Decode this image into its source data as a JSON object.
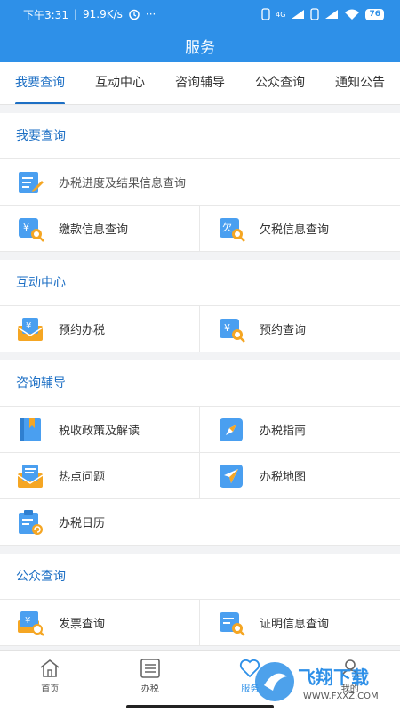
{
  "status": {
    "time": "下午3:31",
    "speed": "91.9K/s",
    "dots": "···",
    "network": "4G",
    "battery": "76"
  },
  "header": {
    "title": "服务"
  },
  "tabs": [
    {
      "label": "我要查询"
    },
    {
      "label": "互动中心"
    },
    {
      "label": "咨询辅导"
    },
    {
      "label": "公众查询"
    },
    {
      "label": "通知公告"
    }
  ],
  "sections": {
    "query": {
      "title": "我要查询",
      "items": [
        "办税进度及结果信息查询",
        "缴款信息查询",
        "欠税信息查询"
      ]
    },
    "interact": {
      "title": "互动中心",
      "items": [
        "预约办税",
        "预约查询"
      ]
    },
    "consult": {
      "title": "咨询辅导",
      "items": [
        "税收政策及解读",
        "办税指南",
        "热点问题",
        "办税地图",
        "办税日历"
      ]
    },
    "public": {
      "title": "公众查询",
      "items": [
        "发票查询",
        "证明信息查询"
      ]
    }
  },
  "bottom_nav": [
    {
      "label": "首页",
      "icon": "home-icon"
    },
    {
      "label": "办税",
      "icon": "list-icon"
    },
    {
      "label": "服务",
      "icon": "heart-icon"
    },
    {
      "label": "我的",
      "icon": "user-icon"
    }
  ],
  "watermark": {
    "brand": "飞翔下载",
    "url": "WWW.FXXZ.COM"
  },
  "colors": {
    "primary": "#2e90e8",
    "accent": "#1d6fc4",
    "orange": "#f5a623"
  }
}
